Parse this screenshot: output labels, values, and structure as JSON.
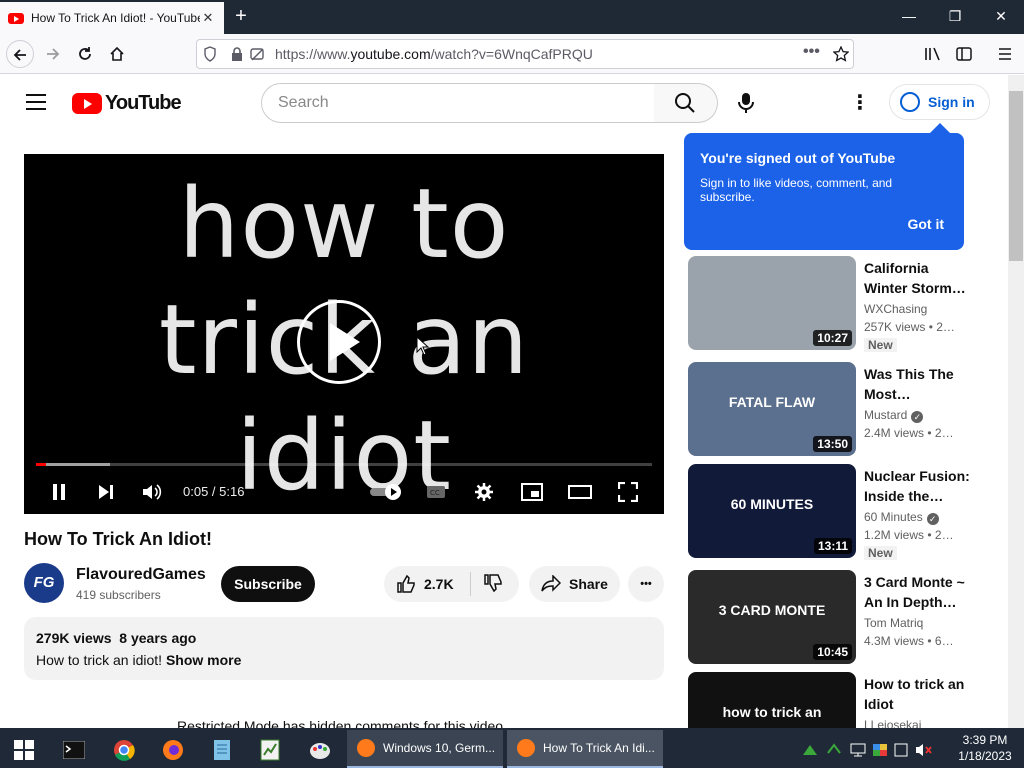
{
  "browser": {
    "tab_title": "How To Trick An Idiot! - YouTube",
    "tab_close": "✕",
    "new_tab": "+",
    "url_prefix": "https://www.",
    "url_domain": "youtube.com",
    "url_path": "/watch?v=6WnqCafPRQU",
    "window_min": "—",
    "window_restore": "❐",
    "window_close": "✕"
  },
  "youtube": {
    "logo_text": "YouTube",
    "search_placeholder": "Search",
    "more_glyph": "⋮",
    "sign_in": "Sign in"
  },
  "tooltip": {
    "title": "You're signed out of YouTube",
    "body": "Sign in to like videos, comment, and subscribe.",
    "action": "Got it"
  },
  "player": {
    "frame_line1": "how to",
    "frame_line2": "trick an",
    "frame_line3": "idiot",
    "time": "0:05 / 5:16",
    "played_fraction": 0.016,
    "loaded_fraction": 0.12
  },
  "video": {
    "title": "How To Trick An Idiot!",
    "channel_initials": "FG",
    "channel": "FlavouredGames",
    "subscribers": "419 subscribers",
    "subscribe_label": "Subscribe",
    "likes": "2.7K",
    "share_label": "Share",
    "more_glyph": "•••",
    "views": "279K views",
    "age": "8 years ago",
    "description": "How to trick an idiot!",
    "show_more": "Show more",
    "hidden_notice": "Restricted Mode has hidden comments for this video."
  },
  "recommendations": [
    {
      "title": "California Winter Storm…",
      "channel": "WXChasing",
      "views": "257K views",
      "age": "• 2…",
      "duration": "10:27",
      "badge": "New",
      "verified": false,
      "thumb_color": "#9aa3ab"
    },
    {
      "title": "Was This The Most…",
      "channel": "Mustard",
      "views": "2.4M views",
      "age": "• 2…",
      "duration": "13:50",
      "badge": "",
      "verified": true,
      "thumb_text": "FATAL FLAW",
      "thumb_color": "#5b6f8e"
    },
    {
      "title": "Nuclear Fusion: Inside the…",
      "channel": "60 Minutes",
      "views": "1.2M views",
      "age": "• 2…",
      "duration": "13:11",
      "badge": "New",
      "verified": true,
      "thumb_text": "60 MINUTES",
      "thumb_color": "#121a3a"
    },
    {
      "title": "3 Card Monte ~ An In Depth…",
      "channel": "Tom Matriq",
      "views": "4.3M views",
      "age": "• 6…",
      "duration": "10:45",
      "badge": "",
      "verified": false,
      "thumb_text": "3 CARD MONTE",
      "thumb_color": "#2a2a2a"
    },
    {
      "title": "How to trick an Idiot",
      "channel": "LLejosekai",
      "views": "",
      "age": "",
      "duration": "",
      "badge": "",
      "verified": false,
      "thumb_text": "how to trick an",
      "thumb_color": "#111111"
    }
  ],
  "taskbar": {
    "apps": [
      {
        "label": "Windows 10, Germ..."
      },
      {
        "label": "How To Trick An Idi..."
      }
    ],
    "time": "3:39 PM",
    "date": "1/18/2023"
  }
}
